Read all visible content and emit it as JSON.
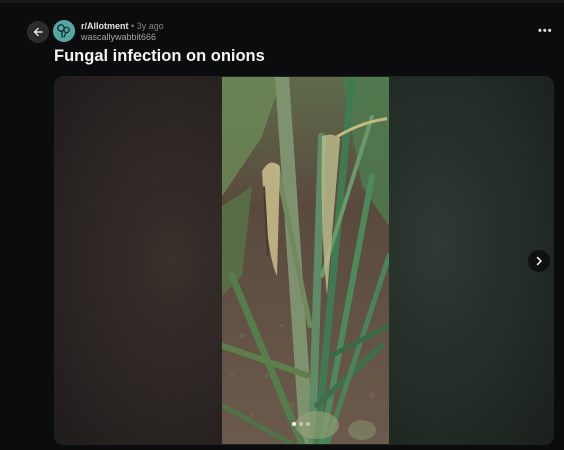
{
  "post": {
    "subreddit": "r/Allotment",
    "separator": "•",
    "time_ago": "3y ago",
    "username": "wascallywabbit666",
    "title": "Fungal infection on onions"
  },
  "gallery": {
    "image_subject": "onion-plants",
    "total_images": 3,
    "current_index": 1
  },
  "icons": {
    "back": "arrow-left-icon",
    "more": "more-horizontal-icon",
    "next": "chevron-right-icon",
    "avatar": "subreddit-avatar-icon"
  },
  "more_label": "•••",
  "colors": {
    "background": "#0b0c0d",
    "avatar_bg": "#57a6a2",
    "text_primary": "#f2f3f5",
    "text_secondary": "#818384"
  }
}
